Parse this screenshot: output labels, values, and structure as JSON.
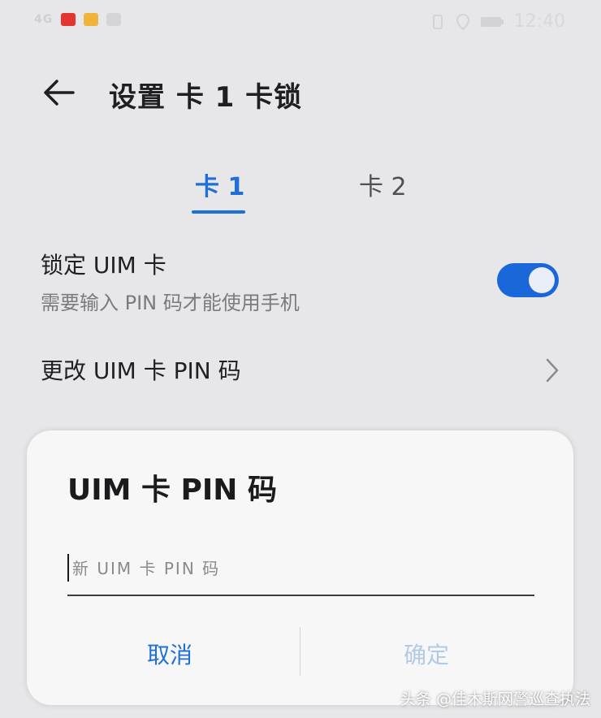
{
  "status_bar": {
    "time": "12:40",
    "signal_label": "4G"
  },
  "header": {
    "title": "设置 卡 1 卡锁"
  },
  "tabs": [
    {
      "label": "卡 1",
      "selected": true
    },
    {
      "label": "卡 2",
      "selected": false
    }
  ],
  "settings": {
    "lock": {
      "title": "锁定 UIM 卡",
      "subtitle": "需要输入 PIN 码才能使用手机",
      "enabled": true
    },
    "change_pin": {
      "title": "更改 UIM 卡 PIN 码"
    }
  },
  "dialog": {
    "title": "UIM 卡 PIN 码",
    "input_placeholder": "新 UIM 卡 PIN 码",
    "input_value": "",
    "cancel_label": "取消",
    "confirm_label": "确定"
  },
  "watermark": "头条 @佳木斯网警巡查执法",
  "colors": {
    "accent": "#1f6fd8",
    "toggle_on": "#1a67d9",
    "confirm_disabled": "#b4c9e8",
    "background": "#e7e7e9",
    "dialog_bg": "#f7f7f8"
  }
}
